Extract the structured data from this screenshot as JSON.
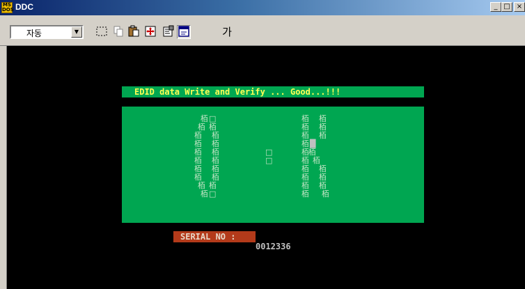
{
  "window": {
    "title": "DDC",
    "icon_text": "MS DOS"
  },
  "window_controls": {
    "minimize": "_",
    "maximize": "□",
    "close": "×"
  },
  "toolbar": {
    "font_combo_value": "자동",
    "combo_arrow": "▼",
    "icons": [
      "mark-icon",
      "copy-icon",
      "paste-icon",
      "fullscreen-icon",
      "properties-icon",
      "background-icon",
      "font-icon"
    ],
    "font_button_label": "가"
  },
  "console": {
    "banner": "EDID data Write and Verify ... Good...!!!",
    "serial_label": "SERIAL NO :",
    "serial_value": "0012336",
    "glyph_char": "栢",
    "box_char": "□",
    "cursor_char": "█",
    "colors": {
      "panel": "#00a651",
      "banner_text": "#ffff55",
      "serial_label_bg": "#b33a1a"
    }
  }
}
